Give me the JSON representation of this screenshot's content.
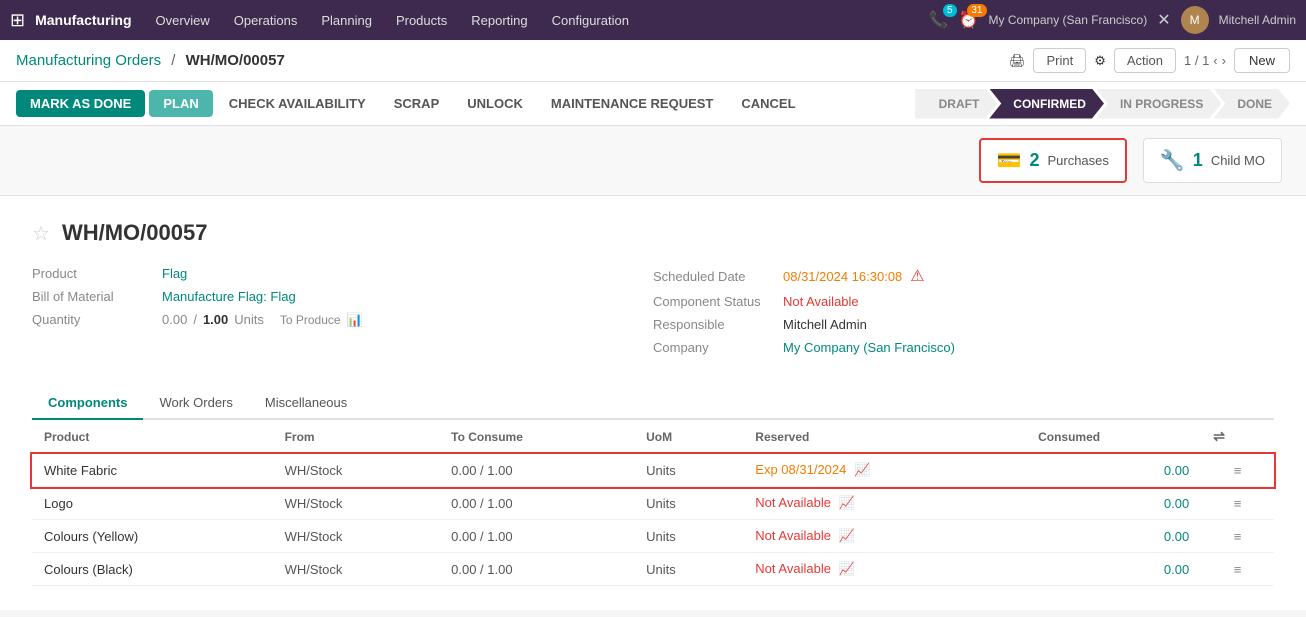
{
  "topnav": {
    "app_name": "Manufacturing",
    "nav_items": [
      "Overview",
      "Operations",
      "Planning",
      "Products",
      "Reporting",
      "Configuration"
    ],
    "badges": [
      {
        "icon": "📞",
        "count": "5",
        "color": "teal"
      },
      {
        "icon": "⏰",
        "count": "31",
        "color": "orange"
      }
    ],
    "company": "My Company (San Francisco)",
    "user": "Mitchell Admin"
  },
  "breadcrumb": {
    "parent": "Manufacturing Orders",
    "current": "WH/MO/00057"
  },
  "toolbar": {
    "print_label": "Print",
    "action_label": "Action",
    "pagination": "1 / 1",
    "new_label": "New"
  },
  "action_buttons": [
    {
      "label": "MARK AS DONE",
      "type": "primary"
    },
    {
      "label": "PLAN",
      "type": "secondary"
    },
    {
      "label": "CHECK AVAILABILITY",
      "type": "text"
    },
    {
      "label": "SCRAP",
      "type": "text"
    },
    {
      "label": "UNLOCK",
      "type": "text"
    },
    {
      "label": "MAINTENANCE REQUEST",
      "type": "text"
    },
    {
      "label": "CANCEL",
      "type": "text"
    }
  ],
  "status_steps": [
    {
      "label": "DRAFT",
      "active": false
    },
    {
      "label": "CONFIRMED",
      "active": true
    },
    {
      "label": "IN PROGRESS",
      "active": false
    },
    {
      "label": "DONE",
      "active": false
    }
  ],
  "smart_buttons": [
    {
      "icon": "💳",
      "count": "2",
      "label": "Purchases",
      "highlighted": true
    },
    {
      "icon": "🔧",
      "count": "1",
      "label": "Child MO",
      "highlighted": false
    }
  ],
  "record": {
    "id": "WH/MO/00057",
    "product_label": "Product",
    "product_value": "Flag",
    "bom_label": "Bill of Material",
    "bom_value": "Manufacture Flag: Flag",
    "quantity_label": "Quantity",
    "quantity_current": "0.00",
    "quantity_sep": "/",
    "quantity_target": "1.00",
    "quantity_unit": "Units",
    "to_produce_label": "To Produce",
    "scheduled_date_label": "Scheduled Date",
    "scheduled_date_value": "08/31/2024 16:30:08",
    "component_status_label": "Component Status",
    "component_status_value": "Not Available",
    "responsible_label": "Responsible",
    "responsible_value": "Mitchell Admin",
    "company_label": "Company",
    "company_value": "My Company (San Francisco)"
  },
  "tabs": [
    {
      "label": "Components",
      "active": true
    },
    {
      "label": "Work Orders",
      "active": false
    },
    {
      "label": "Miscellaneous",
      "active": false
    }
  ],
  "table": {
    "headers": [
      "Product",
      "From",
      "To Consume",
      "UoM",
      "Reserved",
      "Consumed",
      ""
    ],
    "rows": [
      {
        "product": "White Fabric",
        "from": "WH/Stock",
        "to_consume": "0.00 / 1.00",
        "uom": "Units",
        "reserved": "Exp 08/31/2024",
        "reserved_color": "orange",
        "consumed": "0.00",
        "highlighted": true
      },
      {
        "product": "Logo",
        "from": "WH/Stock",
        "to_consume": "0.00 / 1.00",
        "uom": "Units",
        "reserved": "Not Available",
        "reserved_color": "red",
        "consumed": "0.00",
        "highlighted": false
      },
      {
        "product": "Colours (Yellow)",
        "from": "WH/Stock",
        "to_consume": "0.00 / 1.00",
        "uom": "Units",
        "reserved": "Not Available",
        "reserved_color": "red",
        "consumed": "0.00",
        "highlighted": false
      },
      {
        "product": "Colours (Black)",
        "from": "WH/Stock",
        "to_consume": "0.00 / 1.00",
        "uom": "Units",
        "reserved": "Not Available",
        "reserved_color": "red",
        "consumed": "0.00",
        "highlighted": false
      }
    ]
  }
}
